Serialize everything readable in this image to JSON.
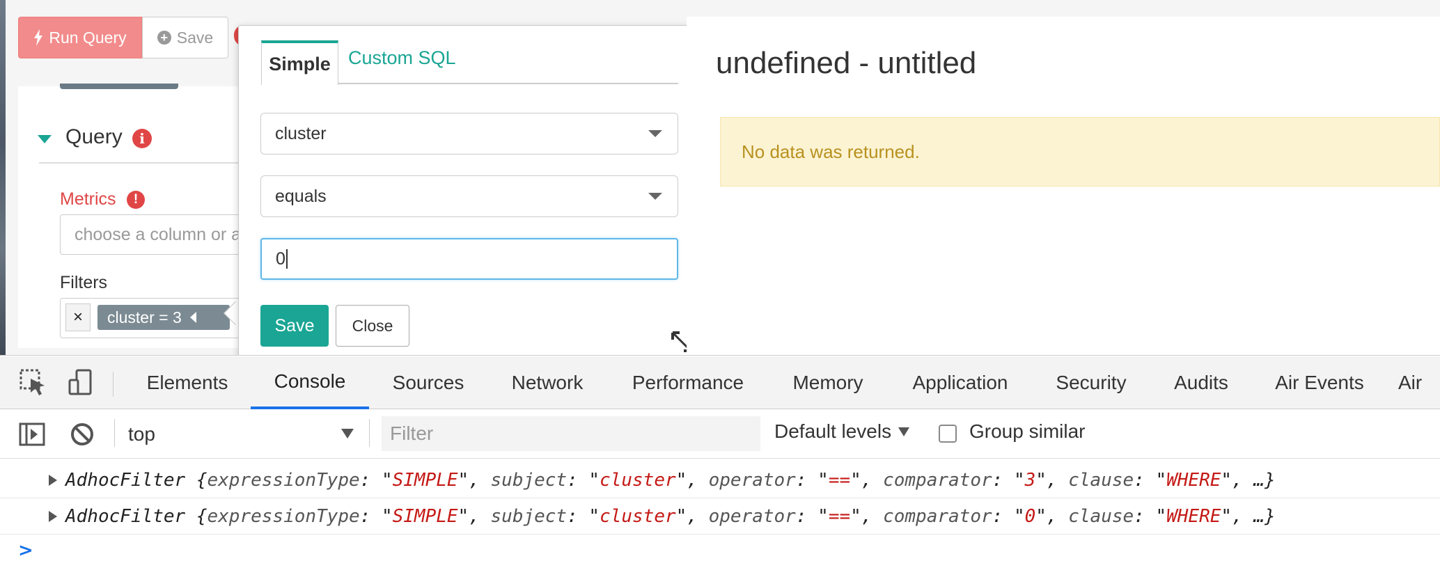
{
  "toolbar": {
    "run_label": "Run Query",
    "save_label": "Save"
  },
  "sidebar": {
    "section_title": "Query",
    "metrics_label": "Metrics",
    "metrics_placeholder": "choose a column or aggregate function",
    "filters_label": "Filters",
    "filter_remove": "×",
    "filter_tag": "cluster = 3"
  },
  "popover": {
    "tabs": [
      {
        "label": "Simple",
        "active": true
      },
      {
        "label": "Custom SQL",
        "active": false
      }
    ],
    "subject_value": "cluster",
    "operator_value": "equals",
    "comparator_value": "0",
    "save_label": "Save",
    "close_label": "Close"
  },
  "result": {
    "title": "undefined - untitled",
    "alert": "No data was returned."
  },
  "devtools": {
    "tabs": [
      "Elements",
      "Console",
      "Sources",
      "Network",
      "Performance",
      "Memory",
      "Application",
      "Security",
      "Audits",
      "Air Events",
      "Air"
    ],
    "active_tab": "Console",
    "context": "top",
    "filter_placeholder": "Filter",
    "levels": "Default levels",
    "group_similar": "Group similar",
    "logs": [
      {
        "class": "AdhocFilter",
        "expressionType": "SIMPLE",
        "subject": "cluster",
        "operator": "==",
        "comparator": "3",
        "clause": "WHERE"
      },
      {
        "class": "AdhocFilter",
        "expressionType": "SIMPLE",
        "subject": "cluster",
        "operator": "==",
        "comparator": "0",
        "clause": "WHERE"
      }
    ],
    "prompt": ">"
  },
  "colors": {
    "accent": "#1aa594",
    "danger": "#e04646",
    "run_button": "#f28b8b",
    "alert_bg": "#fcf3d3",
    "alert_text": "#b8911f",
    "devtools_active": "#1a73e8"
  },
  "icons": [
    "bolt-icon",
    "plus-circle-icon",
    "info-icon",
    "exclamation-icon",
    "caret-down-icon",
    "resize-icon",
    "inspect-icon",
    "device-icon",
    "sidebar-toggle-icon",
    "clear-console-icon"
  ]
}
